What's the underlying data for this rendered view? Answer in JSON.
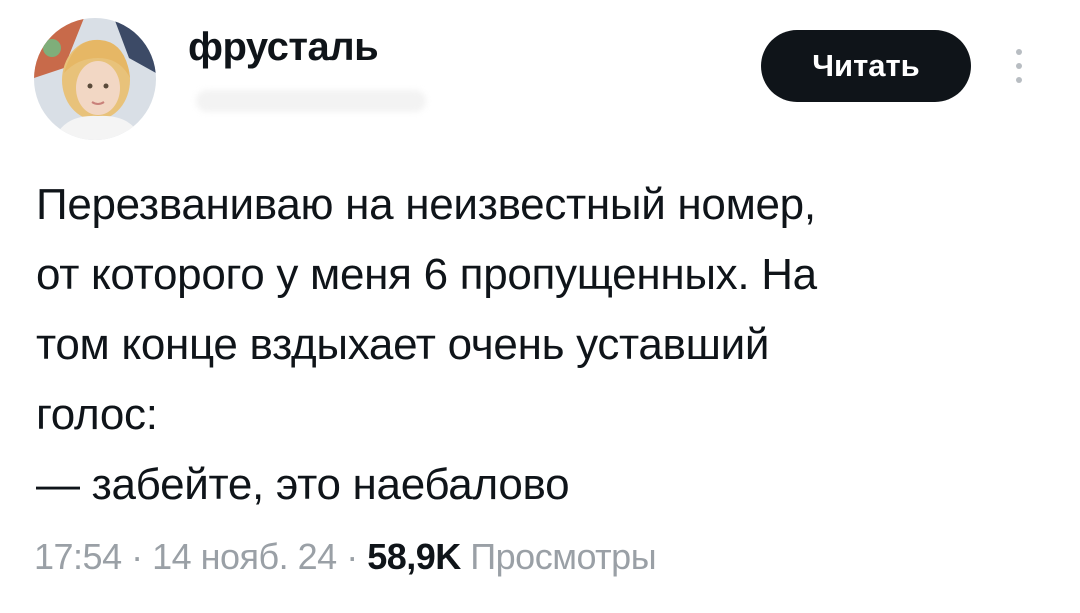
{
  "author": {
    "display_name": "фрусталь",
    "avatar_icon": "user-avatar-photo"
  },
  "actions": {
    "follow_label": "Читать",
    "more_icon": "more-vertical-icon"
  },
  "tweet": {
    "text": "Перезваниваю на неизвестный номер,\nот которого у меня 6 пропущенных. На\nтом конце вздыхает очень уставший\nголос:\n— забейте, это наебалово"
  },
  "meta": {
    "time": "17:54",
    "separator_1": " · ",
    "date": "14 нояб. 24",
    "separator_2": " · ",
    "views_count": "58,9K",
    "views_label": " Просмотры"
  },
  "colors": {
    "text": "#0f1419",
    "secondary": "#9aa0a6",
    "button_bg": "#0f1419",
    "button_text": "#ffffff"
  }
}
